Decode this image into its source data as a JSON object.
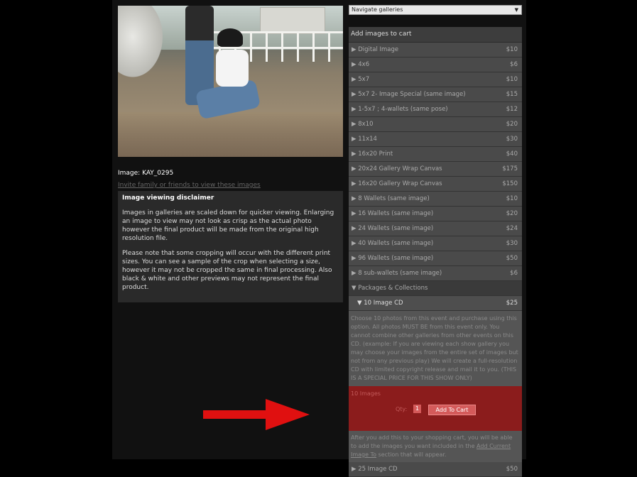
{
  "left": {
    "image_name": "Image: KAY_0295",
    "invite_link": "Invite family or friends to view these images",
    "disclaimer": {
      "title": "Image viewing disclaimer",
      "p1": "Images in galleries are scaled down for quicker viewing. Enlarging an image to view may not look as crisp as the actual photo however the final product will be made from the original high resolution file.",
      "p2": "Please note that some cropping will occur with the different print sizes. You can see a sample of the crop when selecting a size, however it may not be cropped the same in final processing. Also black & white and other previews may not represent the final product."
    }
  },
  "nav": {
    "selected": "Navigate galleries",
    "caret": "▼"
  },
  "cart": {
    "header": "Add images to cart",
    "items": [
      {
        "label": "Digital Image",
        "price": "$10"
      },
      {
        "label": "4x6",
        "price": "$6"
      },
      {
        "label": "5x7",
        "price": "$10"
      },
      {
        "label": "5x7 2- Image Special (same image)",
        "price": "$15"
      },
      {
        "label": "1-5x7 ; 4-wallets (same pose)",
        "price": "$12"
      },
      {
        "label": "8x10",
        "price": "$20"
      },
      {
        "label": "11x14",
        "price": "$30"
      },
      {
        "label": "16x20 Print",
        "price": "$40"
      },
      {
        "label": "20x24 Gallery Wrap Canvas",
        "price": "$175"
      },
      {
        "label": "16x20 Gallery Wrap Canvas",
        "price": "$150"
      },
      {
        "label": "8 Wallets (same image)",
        "price": "$10"
      },
      {
        "label": "16 Wallets (same image)",
        "price": "$20"
      },
      {
        "label": "24 Wallets (same image)",
        "price": "$24"
      },
      {
        "label": "40 Wallets (same image)",
        "price": "$30"
      },
      {
        "label": "96 Wallets (same image)",
        "price": "$50"
      },
      {
        "label": "8 sub-wallets (same image)",
        "price": "$6"
      }
    ],
    "packages_label": "▼ Packages & Collections",
    "cd10": {
      "label": "▼ 10 Image CD",
      "price": "$25",
      "description": "Choose 10 photos from this event and purchase using this option. All photos MUST BE from this event only. You cannot combine other galleries from other events on this CD. (example: If you are viewing each show gallery you may choose your images from the entire set of images but not from any previous play) We will create a full-resolution CD with limited copyright release and mail it to you. (THIS IS A SPECIAL PRICE FOR THIS SHOW ONLY)",
      "count_label": "10 Images",
      "qty_label": "Qty:",
      "qty_value": "1",
      "add_button": "Add To Cart",
      "after_text": "After you add this to your shopping cart, you will be able to add the images you want included in the",
      "after_link": "Add Current Image To",
      "after_tail": "section that will appear."
    },
    "cd25": {
      "label": "▶ 25 Image CD",
      "price": "$50"
    }
  },
  "colors": {
    "accent_red": "#8b1c1c",
    "arrow_red": "#e01010",
    "button": "#d45a5a"
  }
}
